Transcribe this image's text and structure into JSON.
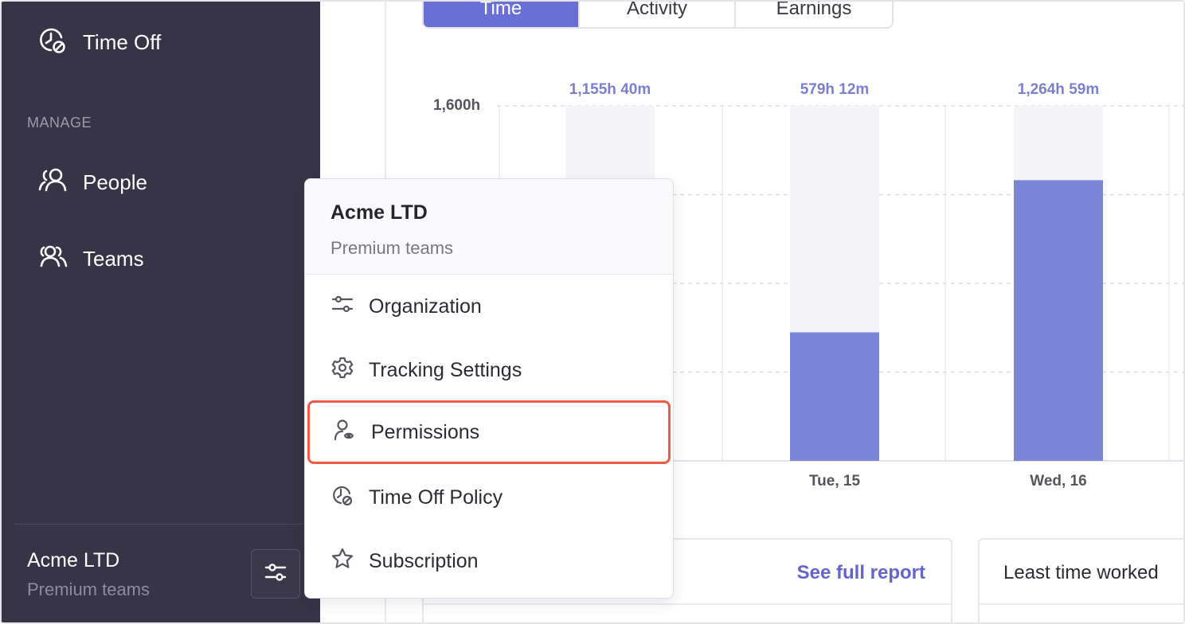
{
  "sidebar": {
    "items": [
      {
        "label": "Time Off",
        "icon": "time-off-icon"
      },
      {
        "label": "People",
        "icon": "people-icon"
      },
      {
        "label": "Teams",
        "icon": "teams-icon"
      }
    ],
    "section_manage": "MANAGE",
    "org": {
      "name": "Acme LTD",
      "plan": "Premium teams"
    }
  },
  "tabs": [
    {
      "label": "Time",
      "active": true
    },
    {
      "label": "Activity",
      "active": false
    },
    {
      "label": "Earnings",
      "active": false
    }
  ],
  "chart_data": {
    "type": "bar",
    "categories": [
      "",
      "Tue, 15",
      "Wed, 16"
    ],
    "values_hours": [
      1155.67,
      579.2,
      1264.98
    ],
    "value_labels": [
      "1,155h 40m",
      "579h 12m",
      "1,264h 59m"
    ],
    "ylim": [
      0,
      1600
    ],
    "y_tick_labels": [
      "1,600h"
    ],
    "grid": true,
    "colors": {
      "bar": "#7b85d8",
      "track": "#f4f4f9",
      "value_label": "#7a80cf"
    }
  },
  "cards": {
    "report_link": "See full report",
    "least_time_title": "Least time worked"
  },
  "menu": {
    "title": "Acme LTD",
    "subtitle": "Premium teams",
    "items": [
      {
        "label": "Organization",
        "icon": "sliders-icon"
      },
      {
        "label": "Tracking Settings",
        "icon": "gear-icon"
      },
      {
        "label": "Permissions",
        "icon": "user-eye-icon",
        "highlighted": true
      },
      {
        "label": "Time Off Policy",
        "icon": "time-off-icon"
      },
      {
        "label": "Subscription",
        "icon": "star-icon"
      }
    ]
  },
  "colors": {
    "sidebar_bg": "#373447",
    "accent": "#6a6fd5",
    "highlight_border": "#ef5a45"
  }
}
